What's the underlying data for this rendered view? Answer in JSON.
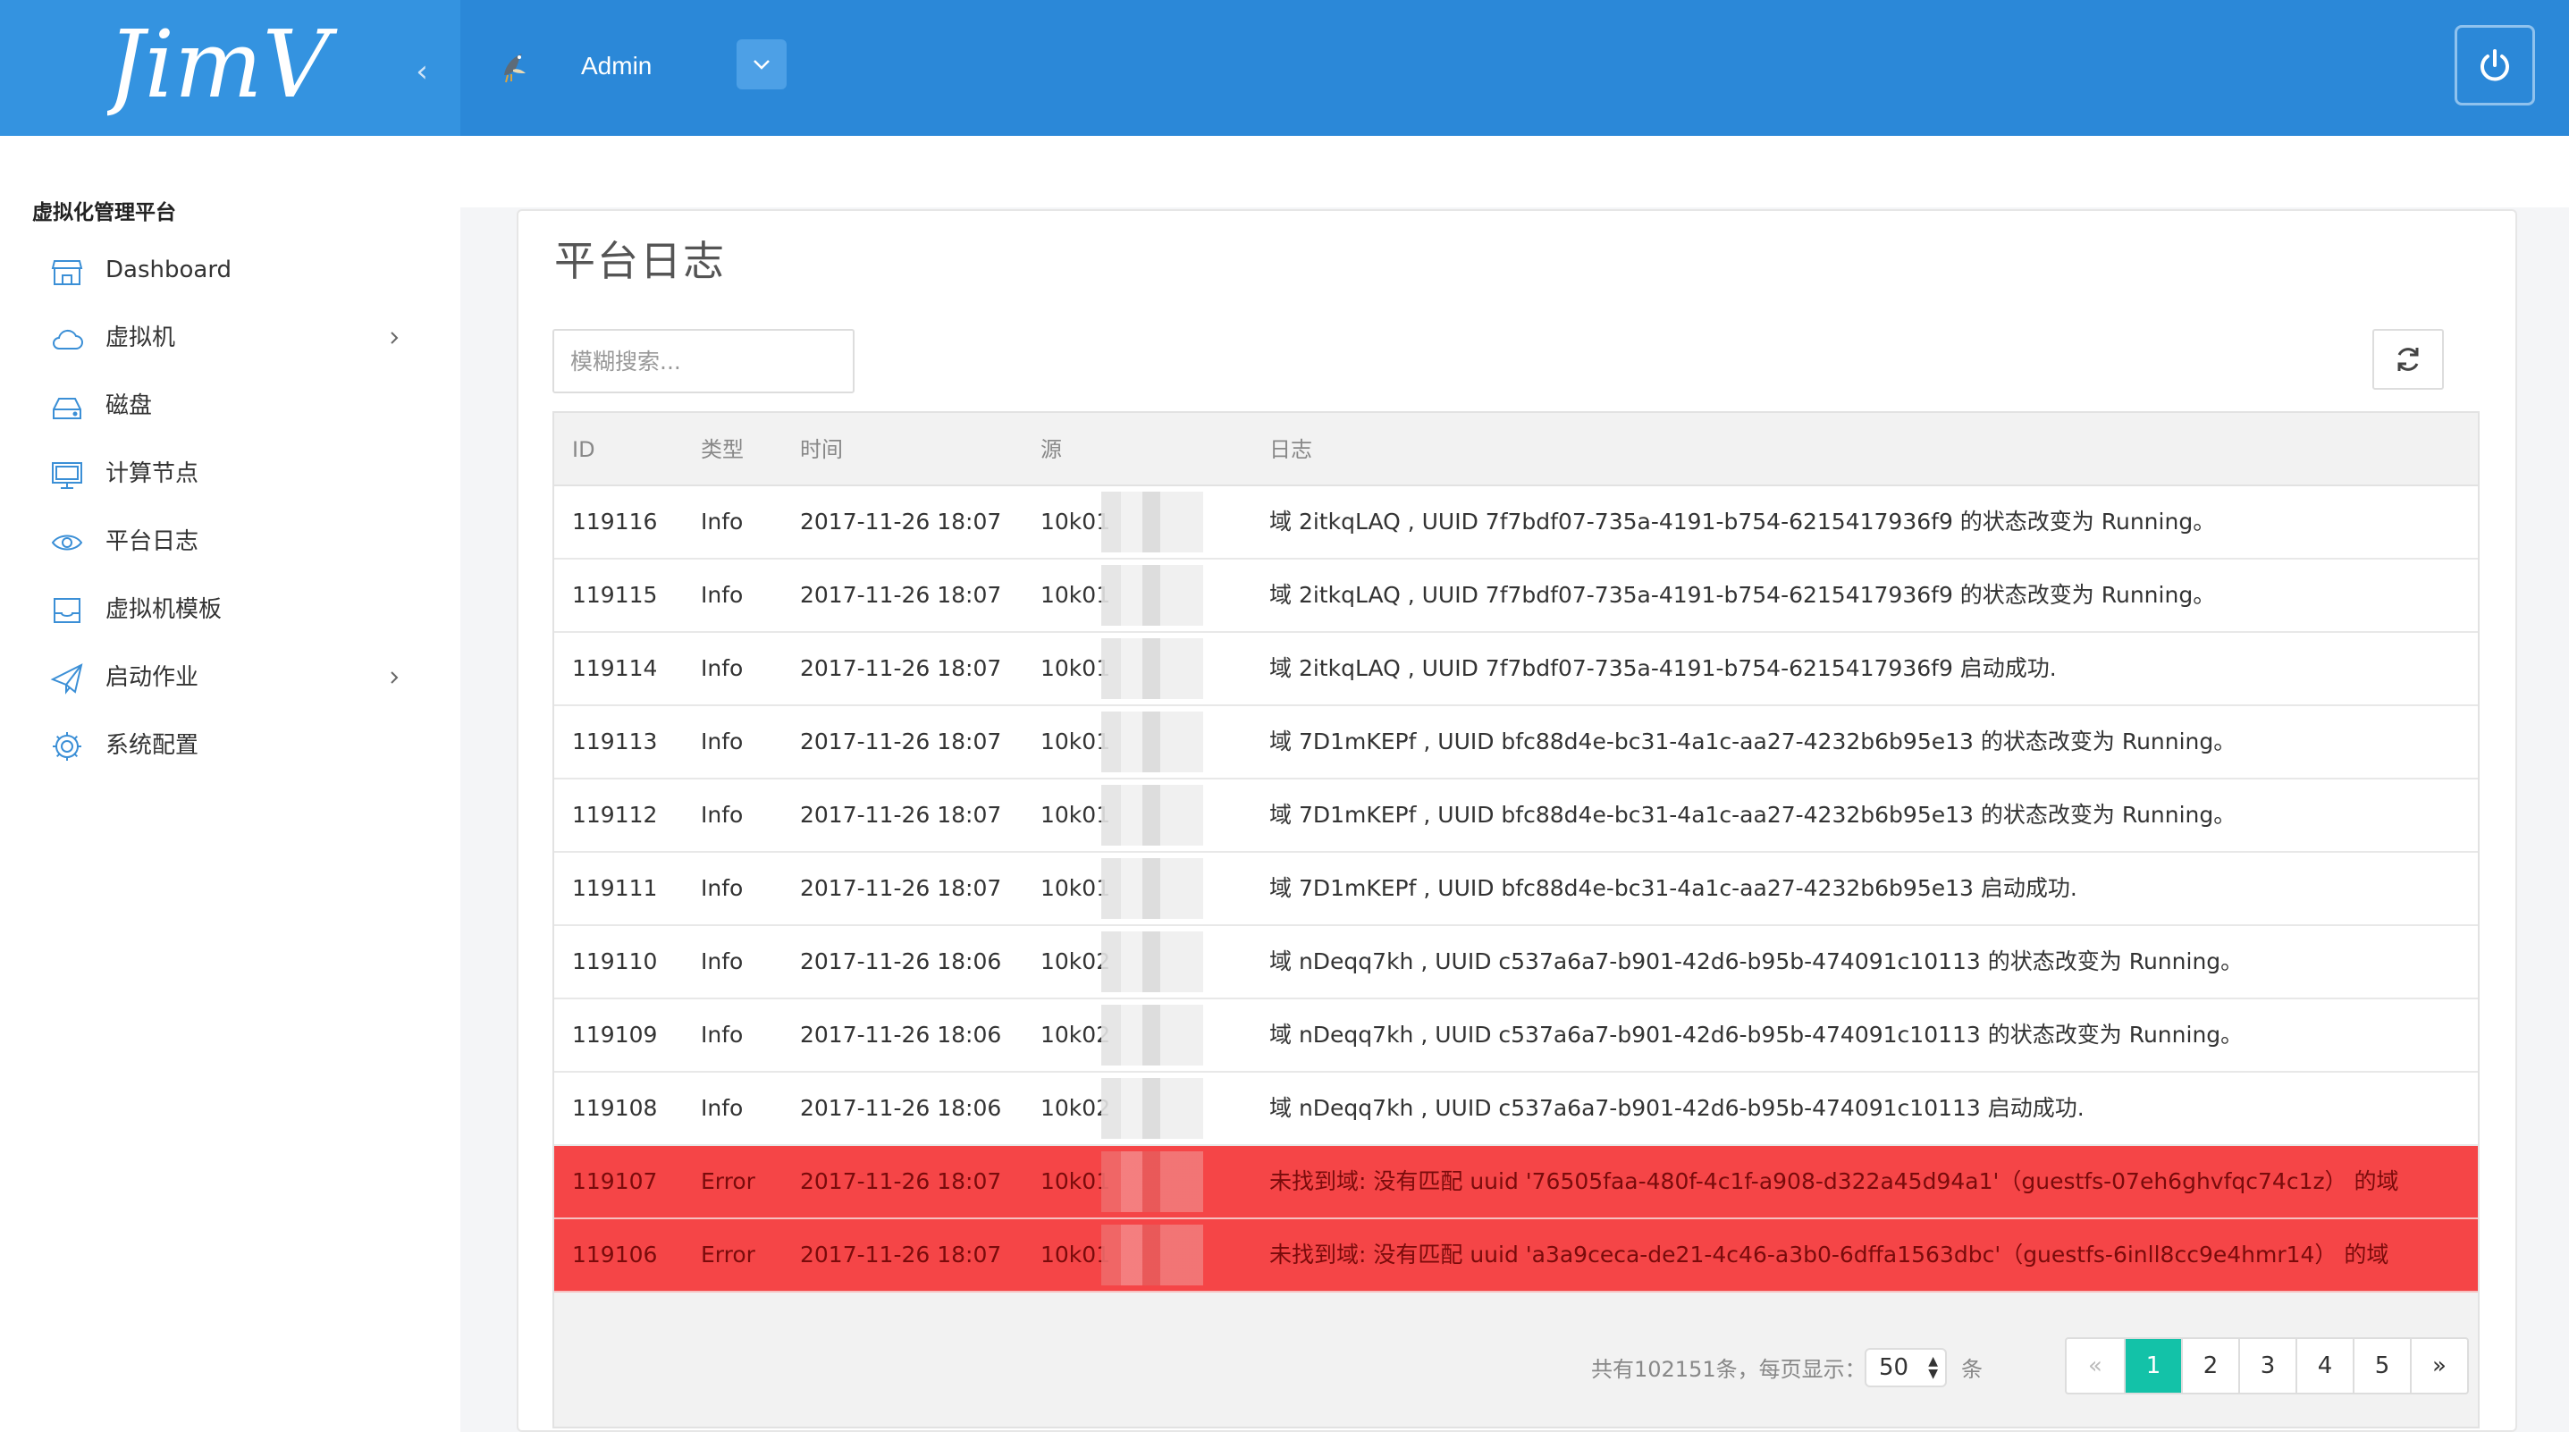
{
  "header": {
    "logo_text": "JimV",
    "user_name": "Admin"
  },
  "sidebar": {
    "title": "虚拟化管理平台",
    "items": [
      {
        "label": "Dashboard",
        "icon": "store-icon"
      },
      {
        "label": "虚拟机",
        "icon": "cloud-icon"
      },
      {
        "label": "磁盘",
        "icon": "disk-icon"
      },
      {
        "label": "计算节点",
        "icon": "monitor-icon"
      },
      {
        "label": "平台日志",
        "icon": "eye-icon"
      },
      {
        "label": "虚拟机模板",
        "icon": "inbox-icon"
      },
      {
        "label": "启动作业",
        "icon": "paper-plane-icon"
      },
      {
        "label": "系统配置",
        "icon": "gear-icon"
      }
    ]
  },
  "main": {
    "title": "平台日志",
    "search_placeholder": "模糊搜索...",
    "columns": {
      "id": "ID",
      "type": "类型",
      "time": "时间",
      "source": "源",
      "log": "日志"
    },
    "rows": [
      {
        "id": "119116",
        "type": "Info",
        "time": "2017-11-26 18:07",
        "source": "10k01",
        "log": "域 2itkqLAQ , UUID 7f7bdf07-735a-4191-b754-6215417936f9 的状态改变为 Running。"
      },
      {
        "id": "119115",
        "type": "Info",
        "time": "2017-11-26 18:07",
        "source": "10k01",
        "log": "域 2itkqLAQ , UUID 7f7bdf07-735a-4191-b754-6215417936f9 的状态改变为 Running。"
      },
      {
        "id": "119114",
        "type": "Info",
        "time": "2017-11-26 18:07",
        "source": "10k01",
        "log": "域 2itkqLAQ , UUID 7f7bdf07-735a-4191-b754-6215417936f9 启动成功."
      },
      {
        "id": "119113",
        "type": "Info",
        "time": "2017-11-26 18:07",
        "source": "10k01",
        "log": "域 7D1mKEPf , UUID bfc88d4e-bc31-4a1c-aa27-4232b6b95e13 的状态改变为 Running。"
      },
      {
        "id": "119112",
        "type": "Info",
        "time": "2017-11-26 18:07",
        "source": "10k01",
        "log": "域 7D1mKEPf , UUID bfc88d4e-bc31-4a1c-aa27-4232b6b95e13 的状态改变为 Running。"
      },
      {
        "id": "119111",
        "type": "Info",
        "time": "2017-11-26 18:07",
        "source": "10k01",
        "log": "域 7D1mKEPf , UUID bfc88d4e-bc31-4a1c-aa27-4232b6b95e13 启动成功."
      },
      {
        "id": "119110",
        "type": "Info",
        "time": "2017-11-26 18:06",
        "source": "10k02",
        "log": "域 nDeqq7kh , UUID c537a6a7-b901-42d6-b95b-474091c10113 的状态改变为 Running。"
      },
      {
        "id": "119109",
        "type": "Info",
        "time": "2017-11-26 18:06",
        "source": "10k02",
        "log": "域 nDeqq7kh , UUID c537a6a7-b901-42d6-b95b-474091c10113 的状态改变为 Running。"
      },
      {
        "id": "119108",
        "type": "Info",
        "time": "2017-11-26 18:06",
        "source": "10k02",
        "log": "域 nDeqq7kh , UUID c537a6a7-b901-42d6-b95b-474091c10113 启动成功."
      },
      {
        "id": "119107",
        "type": "Error",
        "time": "2017-11-26 18:07",
        "source": "10k01",
        "log": "未找到域: 没有匹配 uuid '76505faa-480f-4c1f-a908-d322a45d94a1'（guestfs-07eh6ghvfqc74c1z） 的域"
      },
      {
        "id": "119106",
        "type": "Error",
        "time": "2017-11-26 18:07",
        "source": "10k01",
        "log": "未找到域: 没有匹配 uuid 'a3a9ceca-de21-4c46-a3b0-6dffa1563dbc'（guestfs-6inll8cc9e4hmr14） 的域"
      }
    ],
    "footer": {
      "total_text": "共有102151条，每页显示：",
      "per_page": "50",
      "unit": "条",
      "pages": [
        "«",
        "1",
        "2",
        "3",
        "4",
        "5",
        "»"
      ],
      "active_page": "1"
    }
  },
  "colors": {
    "header": "#2b88d8",
    "error_row": "#f54547",
    "active_page": "#13c2a8"
  }
}
